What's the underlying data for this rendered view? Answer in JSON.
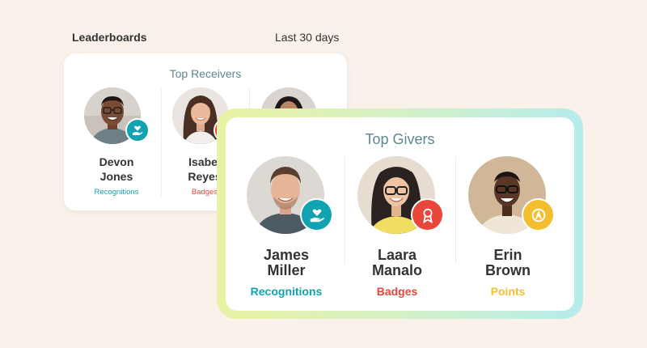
{
  "header": {
    "title": "Leaderboards",
    "range": "Last 30 days"
  },
  "colors": {
    "recognitions": "#11a3b0",
    "badges": "#e8473b",
    "points": "#f3bf31",
    "card_title": "#5e878f"
  },
  "top_receivers": {
    "title": "Top Receivers",
    "people": [
      {
        "first": "Devon",
        "last": "Jones",
        "metric": "Recognitions",
        "icon": "heart-hand-icon"
      },
      {
        "first": "Isabel",
        "last": "Reyes",
        "metric": "Badges",
        "icon": "award-icon"
      },
      {
        "first": "",
        "last": "",
        "metric": "",
        "icon": ""
      }
    ]
  },
  "top_givers": {
    "title": "Top Givers",
    "people": [
      {
        "first": "James",
        "last": "Miller",
        "metric": "Recognitions",
        "icon": "heart-hand-icon"
      },
      {
        "first": "Laara",
        "last": "Manalo",
        "metric": "Badges",
        "icon": "award-icon"
      },
      {
        "first": "Erin",
        "last": "Brown",
        "metric": "Points",
        "icon": "points-coin-icon"
      }
    ]
  }
}
